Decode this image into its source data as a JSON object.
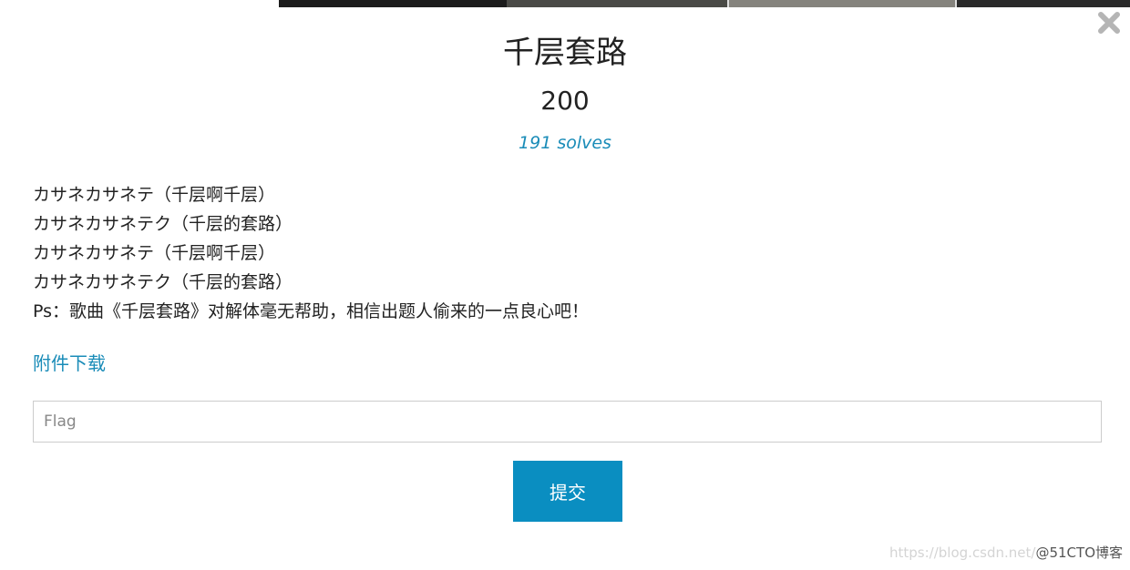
{
  "modal": {
    "title": "千层套路",
    "value": "200",
    "solves": "191 solves",
    "description_lines": [
      "カサネカサネテ（千层啊千层）",
      "カサネカサネテク（千层的套路）",
      "カサネカサネテ（千层啊千层）",
      "カサネカサネテク（千层的套路）",
      "Ps：歌曲《千层套路》对解体毫无帮助，相信出题人偷来的一点良心吧！"
    ],
    "attachment_label": "附件下载",
    "flag_placeholder": "Flag",
    "flag_value": "",
    "submit_label": "提交",
    "close_icon": "close-icon",
    "accent_color": "#1a8cb8",
    "button_color": "#0a8ec1"
  },
  "watermark": {
    "url_text": "https://blog.csdn.net/",
    "brand_text": "@51CTO博客"
  }
}
